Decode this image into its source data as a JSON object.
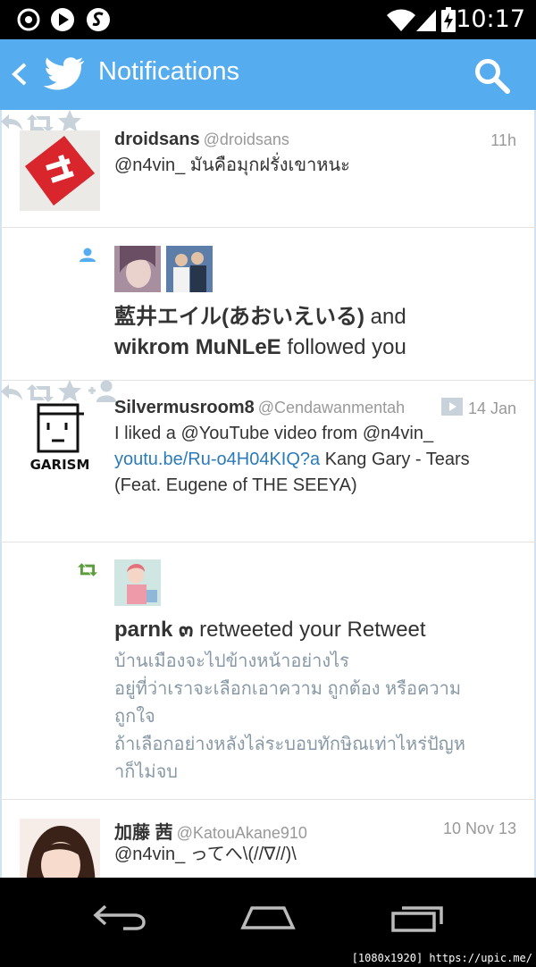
{
  "status_bar": {
    "time": "10:17"
  },
  "app_bar": {
    "title": "Notifications"
  },
  "notifications": [
    {
      "kind": "mention",
      "name": "droidsans",
      "handle": "@droidsans",
      "time": "11h",
      "text": "@n4vin_ มันคือมุกฝรั่งเขาหนะ"
    },
    {
      "kind": "follow",
      "line1_name": "藍井エイル(あおいえいる)",
      "line1_suffix": " and",
      "line2_name": "wikrom MuNLeE",
      "line2_suffix": " followed you"
    },
    {
      "kind": "tweet",
      "name": "Silvermusroom8",
      "handle": "@Cendawanmentah",
      "time": "14 Jan",
      "avatar_label": "GARISM",
      "line1": "I liked a @YouTube video from @n4vin_",
      "link": "youtu.be/Ru-o4H04KIQ?a",
      "line2_rest": " Kang Gary - Tears",
      "line3": "(Feat. Eugene of THE SEEYA)"
    },
    {
      "kind": "retweet",
      "name": "parnk ๓",
      "suffix": " retweeted your Retweet",
      "quote_lines": [
        "บ้านเมืองจะไปข้างหน้าอย่างไร",
        "อยู่ที่ว่าเราจะเลือกเอาความ ถูกต้อง หรือความ",
        "ถูกใจ",
        "ถ้าเลือกอย่างหลังไล่ระบอบทักษิณเท่าไหร่ปัญห",
        "าก็ไม่จบ"
      ]
    },
    {
      "kind": "mention",
      "name": "加藤 茜",
      "handle": "@KatouAkane910",
      "time": "10 Nov 13",
      "text": "@n4vin_ ってへ\\(//∇//)\\"
    }
  ],
  "watermark": "[1080x1920] https://upic.me/",
  "colors": {
    "accent": "#55acee",
    "action_icon": "#c7d2da",
    "retweet_green": "#5c9e3e",
    "link": "#2b7bb9"
  }
}
